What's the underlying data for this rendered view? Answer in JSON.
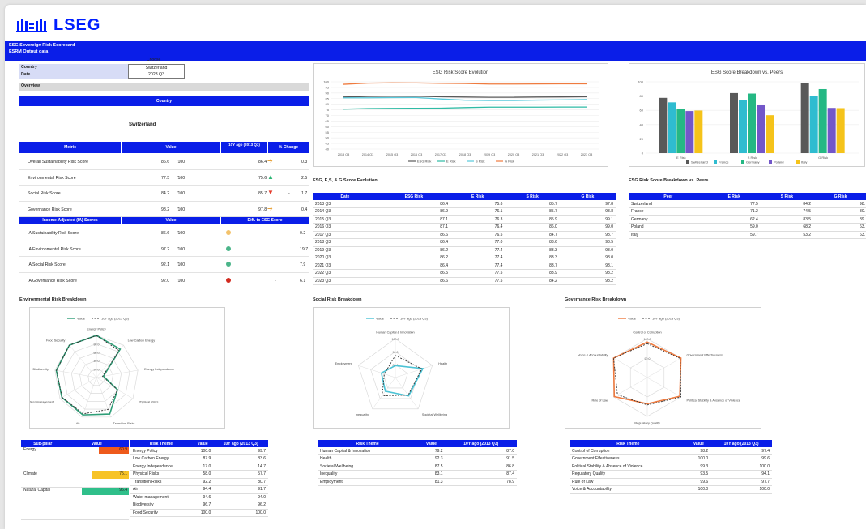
{
  "brand": {
    "name": "LSEG",
    "color": "#001eff"
  },
  "banner": {
    "line1": "ESG Sovereign Risk Scorecard",
    "line2": "ESRM Output data"
  },
  "selector": {
    "choose": "Choose",
    "country_label": "Country",
    "country_value": "Switzerland",
    "date_label": "Date",
    "date_value": "2023 Q3"
  },
  "overview": {
    "title": "Overview",
    "country_header": "Country",
    "country_name": "Switzerland"
  },
  "metrics": {
    "headers": [
      "Metric",
      "Value",
      "10Y ago (2013 Q3)",
      "% Change"
    ],
    "rows": [
      {
        "name": "Overall Sustainability Risk Score",
        "value": "86.6",
        "unit": "/100",
        "past": "86.4",
        "arrow": "➔",
        "arrow_color": "#e8a33c",
        "change": "0.3",
        "sign": ""
      },
      {
        "name": "Environmental Risk Score",
        "value": "77.5",
        "unit": "/100",
        "past": "75.6",
        "arrow": "▲",
        "arrow_color": "#2bb573",
        "change": "2.5",
        "sign": ""
      },
      {
        "name": "Social Risk Score",
        "value": "84.2",
        "unit": "/100",
        "past": "85.7",
        "arrow": "▼",
        "arrow_color": "#e53b2b",
        "change": "1.7",
        "sign": "-"
      },
      {
        "name": "Governance Risk Score",
        "value": "98.2",
        "unit": "/100",
        "past": "97.8",
        "arrow": "➔",
        "arrow_color": "#e8a33c",
        "change": "0.4",
        "sign": ""
      }
    ],
    "ia_headers": [
      "Income-Adjusted (IA) Scores",
      "Value",
      "Diff. to ESG Score"
    ],
    "ia_rows": [
      {
        "name": "IA Sustainability Risk Score",
        "value": "86.6",
        "unit": "/100",
        "dot_color": "#f3c26b",
        "sign": "",
        "diff": "0.2"
      },
      {
        "name": "IA Environmental Risk Score",
        "value": "97.2",
        "unit": "/100",
        "dot_color": "#4bb58a",
        "sign": "",
        "diff": "19.7"
      },
      {
        "name": "IA Social Risk Score",
        "value": "92.1",
        "unit": "/100",
        "dot_color": "#4bb58a",
        "sign": "",
        "diff": "7.9"
      },
      {
        "name": "IA Governance Risk Score",
        "value": "92.0",
        "unit": "/100",
        "dot_color": "#d22a1f",
        "sign": "-",
        "diff": "6.1"
      }
    ]
  },
  "evolution_chart": {
    "title": "ESG Risk Score Evolution",
    "chart_data": {
      "type": "line",
      "x": [
        "2013 Q3",
        "2014 Q3",
        "2015 Q3",
        "2016 Q3",
        "2017 Q3",
        "2018 Q3",
        "2019 Q3",
        "2020 Q3",
        "2021 Q3",
        "2022 Q3",
        "2023 Q3"
      ],
      "ylim": [
        40,
        100
      ],
      "yticks": [
        "40",
        "45",
        "50",
        "55",
        "60",
        "65",
        "70",
        "75",
        "80",
        "85",
        "90",
        "95",
        "100"
      ],
      "series": [
        {
          "name": "ESG Risk",
          "color": "#595959",
          "values": [
            86.4,
            86.9,
            87.1,
            87.1,
            86.6,
            86.4,
            86.2,
            86.2,
            86.4,
            86.5,
            86.6
          ]
        },
        {
          "name": "E Risk",
          "color": "#2fbba5",
          "values": [
            75.6,
            76.1,
            76.3,
            76.4,
            76.5,
            77.0,
            77.4,
            77.4,
            77.4,
            77.5,
            77.5
          ]
        },
        {
          "name": "S Risk",
          "color": "#58c9dc",
          "values": [
            85.7,
            85.7,
            85.9,
            86.0,
            84.7,
            83.6,
            83.3,
            83.3,
            83.7,
            83.9,
            84.2
          ]
        },
        {
          "name": "G Risk",
          "color": "#ef7b3f",
          "values": [
            97.8,
            98.8,
            99.1,
            99.0,
            98.7,
            98.5,
            98.0,
            98.0,
            98.1,
            98.2,
            98.2
          ]
        }
      ]
    }
  },
  "peers_chart": {
    "title": "ESG Score Breakdown vs. Peers",
    "chart_data": {
      "type": "bar",
      "categories": [
        "E Risk",
        "S Risk",
        "G Risk"
      ],
      "ylim": [
        0,
        100
      ],
      "yticks": [
        "0",
        "20",
        "40",
        "60",
        "80",
        "100"
      ],
      "series": [
        {
          "name": "Switzerland",
          "color": "#595959",
          "values": [
            77.5,
            84.2,
            98.2
          ]
        },
        {
          "name": "France",
          "color": "#2fbcd0",
          "values": [
            71.2,
            74.5,
            80.5
          ]
        },
        {
          "name": "Germany",
          "color": "#25b884",
          "values": [
            62.4,
            83.5,
            89.8
          ]
        },
        {
          "name": "Poland",
          "color": "#7357c9",
          "values": [
            59.0,
            68.2,
            63.4
          ]
        },
        {
          "name": "Italy",
          "color": "#f5c31a",
          "values": [
            59.7,
            53.2,
            63.1
          ]
        }
      ]
    }
  },
  "evolution_table": {
    "title": "ESG, E,S, & G Score Evolution",
    "headers": [
      "Date",
      "ESG Risk",
      "E Risk",
      "S Risk",
      "G Risk"
    ],
    "rows": [
      [
        "2013 Q3",
        "86.4",
        "75.6",
        "85.7",
        "97.8"
      ],
      [
        "2014 Q3",
        "86.9",
        "76.1",
        "85.7",
        "98.8"
      ],
      [
        "2015 Q3",
        "87.1",
        "76.3",
        "85.9",
        "99.1"
      ],
      [
        "2016 Q3",
        "87.1",
        "76.4",
        "86.0",
        "99.0"
      ],
      [
        "2017 Q3",
        "86.6",
        "76.5",
        "84.7",
        "98.7"
      ],
      [
        "2018 Q3",
        "86.4",
        "77.0",
        "83.6",
        "98.5"
      ],
      [
        "2019 Q3",
        "86.2",
        "77.4",
        "83.3",
        "98.0"
      ],
      [
        "2020 Q3",
        "86.2",
        "77.4",
        "83.3",
        "98.0"
      ],
      [
        "2021 Q3",
        "86.4",
        "77.4",
        "83.7",
        "98.1"
      ],
      [
        "2022 Q3",
        "86.5",
        "77.5",
        "83.9",
        "98.2"
      ],
      [
        "2023 Q3",
        "86.6",
        "77.5",
        "84.2",
        "98.2"
      ]
    ]
  },
  "peers_table": {
    "title": "ESG Risk Score Breakdown vs. Peers",
    "headers": [
      "Peer",
      "E Risk",
      "S Risk",
      "G Risk"
    ],
    "rows": [
      [
        "Switzerland",
        "77.5",
        "84.2",
        "98."
      ],
      [
        "France",
        "71.2",
        "74.5",
        "80."
      ],
      [
        "Germany",
        "62.4",
        "83.5",
        "89."
      ],
      [
        "Poland",
        "59.0",
        "68.2",
        "63."
      ],
      [
        "Italy",
        "59.7",
        "53.2",
        "63."
      ]
    ]
  },
  "env": {
    "title": "Environmental Risk Breakdown",
    "legend_value": "Value",
    "legend_past": "10Y ago (2013 Q3)",
    "color": "#2e9e77",
    "radar_ticks": [
      "20.0",
      "40.0",
      "60.0",
      "80.0",
      "100.0"
    ],
    "chart_data": {
      "type": "radar",
      "axes": [
        "Energy Policy",
        "Low Carbon Energy",
        "Energy Independence",
        "Physical Risks",
        "Transition Risks",
        "Air",
        "Water management",
        "Biodiversity",
        "Food Security"
      ],
      "series": [
        {
          "name": "Value",
          "values": [
            100.0,
            87.9,
            17.0,
            58.0,
            92.2,
            94.4,
            94.6,
            96.7,
            100.0
          ]
        },
        {
          "name": "10Y ago (2013 Q3)",
          "values": [
            99.7,
            83.6,
            14.7,
            57.7,
            80.7,
            91.7,
            94.0,
            96.2,
            100.0
          ]
        }
      ]
    },
    "subpillar_headers": [
      "Sub-pillar",
      "Value"
    ],
    "subpillars": [
      {
        "name": "Energy",
        "value": "60.9",
        "color": "#ee5a1c"
      },
      {
        "name": "Climate",
        "value": "75.1",
        "color": "#f7c326"
      },
      {
        "name": "Natural Capital",
        "value": "96.4",
        "color": "#2fbf8a"
      }
    ],
    "theme_headers": [
      "Risk Theme",
      "Value",
      "10Y ago (2013 Q3)"
    ],
    "themes": [
      [
        "Energy Policy",
        "100.0",
        "99.7"
      ],
      [
        "Low Carbon Energy",
        "87.9",
        "83.6"
      ],
      [
        "Energy Independence",
        "17.0",
        "14.7"
      ],
      [
        "Physical Risks",
        "58.0",
        "57.7"
      ],
      [
        "Transition Risks",
        "92.2",
        "80.7"
      ],
      [
        "Air",
        "94.4",
        "91.7"
      ],
      [
        "Water management",
        "94.6",
        "94.0"
      ],
      [
        "Biodiversity",
        "96.7",
        "96.2"
      ],
      [
        "Food Security",
        "100.0",
        "100.0"
      ]
    ]
  },
  "soc": {
    "title": "Social Risk Breakdown",
    "legend_value": "Value",
    "legend_past": "10Y ago (2013 Q3)",
    "color": "#4cc3d5",
    "radar_ticks": [
      "80.0",
      "90.0",
      "100.0"
    ],
    "chart_data": {
      "type": "radar",
      "axes": [
        "Human Capital & Innovation",
        "Health",
        "Societal Wellbeing",
        "Inequality",
        "Employment"
      ],
      "series": [
        {
          "name": "Value",
          "values": [
            79.2,
            92.3,
            87.5,
            83.1,
            81.3
          ]
        },
        {
          "name": "10Y ago (2013 Q3)",
          "values": [
            87.0,
            91.5,
            86.8,
            87.4,
            78.9
          ]
        }
      ]
    },
    "theme_headers": [
      "Risk Theme",
      "Value",
      "10Y ago (2013 Q3)"
    ],
    "themes": [
      [
        "Human Capital & Innovation",
        "79.2",
        "87.0"
      ],
      [
        "Health",
        "92.3",
        "91.5"
      ],
      [
        "Societal Wellbeing",
        "87.5",
        "86.8"
      ],
      [
        "Inequality",
        "83.1",
        "87.4"
      ],
      [
        "Employment",
        "81.3",
        "78.9"
      ]
    ]
  },
  "gov": {
    "title": "Governance Risk Breakdown",
    "legend_value": "Value",
    "legend_past": "10Y ago (2013 Q3)",
    "color": "#ee7a3f",
    "radar_ticks": [
      "90.0",
      "100.0"
    ],
    "chart_data": {
      "type": "radar",
      "axes": [
        "Control of Corruption",
        "Government Effectiveness",
        "Political Stability & Absence of Violence",
        "Regulatory Quality",
        "Rule of Law",
        "Voice & Accountability"
      ],
      "series": [
        {
          "name": "Value",
          "values": [
            98.2,
            100.0,
            99.3,
            93.5,
            99.6,
            100.0
          ]
        },
        {
          "name": "10Y ago (2013 Q3)",
          "values": [
            97.4,
            99.6,
            100.0,
            94.1,
            97.7,
            100.0
          ]
        }
      ]
    },
    "theme_headers": [
      "Risk Theme",
      "Value",
      "10Y ago (2013 Q3)"
    ],
    "themes": [
      [
        "Control of Corruption",
        "98.2",
        "97.4"
      ],
      [
        "Government Effectiveness",
        "100.0",
        "99.6"
      ],
      [
        "Political Stability & Absence of Violence",
        "99.3",
        "100.0"
      ],
      [
        "Regulatory Quality",
        "93.5",
        "94.1"
      ],
      [
        "Rule of Law",
        "99.6",
        "97.7"
      ],
      [
        "Voice & Accountability",
        "100.0",
        "100.0"
      ]
    ]
  }
}
